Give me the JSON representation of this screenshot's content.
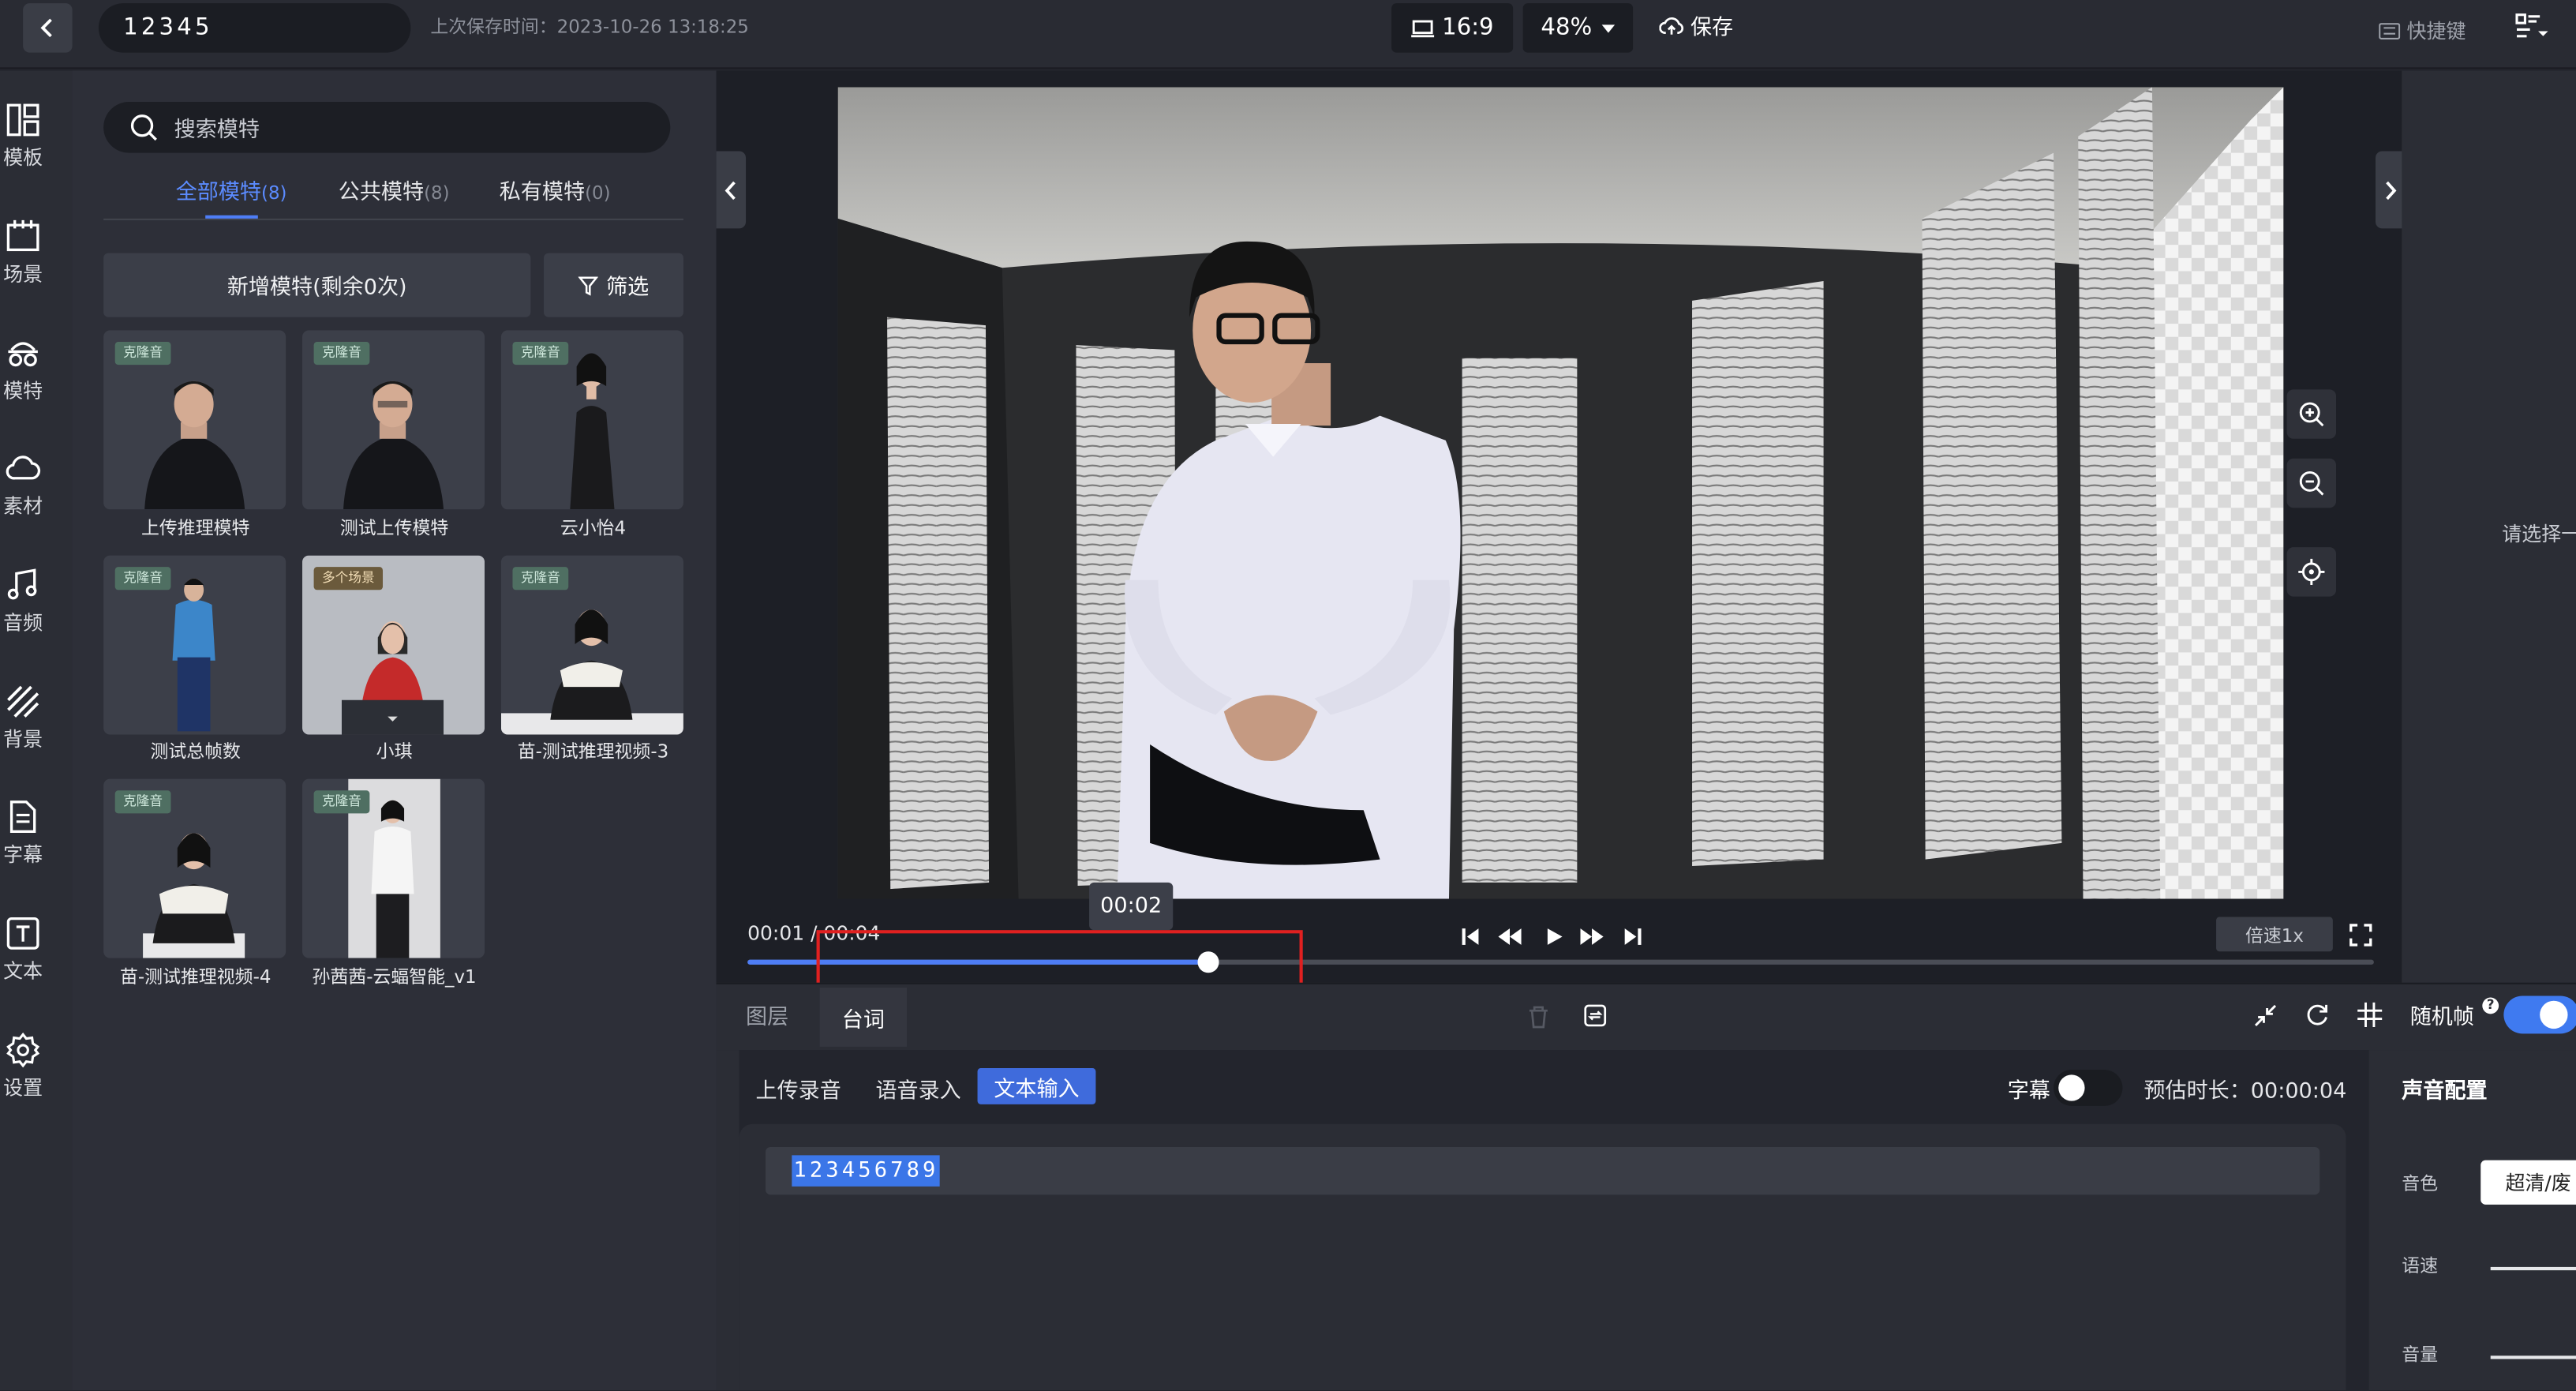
{
  "header": {
    "project_name": "12345",
    "last_saved": "上次保存时间：2023-10-26 13:18:25",
    "aspect_ratio": "16:9",
    "zoom": "48%",
    "save_label": "保存",
    "shortcut_label": "快捷键"
  },
  "left_rail": {
    "items": [
      {
        "label": "模板",
        "icon": "template-icon"
      },
      {
        "label": "场景",
        "icon": "scene-icon"
      },
      {
        "label": "模特",
        "icon": "model-icon"
      },
      {
        "label": "素材",
        "icon": "material-icon"
      },
      {
        "label": "音频",
        "icon": "audio-icon"
      },
      {
        "label": "背景",
        "icon": "background-icon"
      },
      {
        "label": "字幕",
        "icon": "subtitle-icon"
      },
      {
        "label": "文本",
        "icon": "text-icon"
      },
      {
        "label": "设置",
        "icon": "settings-icon"
      }
    ]
  },
  "model_panel": {
    "search_placeholder": "搜索模特",
    "tabs": [
      {
        "label": "全部模特",
        "count": "(8)",
        "active": true
      },
      {
        "label": "公共模特",
        "count": "(8)",
        "active": false
      },
      {
        "label": "私有模特",
        "count": "(0)",
        "active": false
      }
    ],
    "add_model_label": "新增模特(剩余0次)",
    "filter_label": "筛选",
    "models": [
      {
        "name": "上传推理模特",
        "badge": "克隆音"
      },
      {
        "name": "测试上传模特",
        "badge": "克隆音"
      },
      {
        "name": "云小怡4",
        "badge": "克隆音"
      },
      {
        "name": "测试总帧数",
        "badge": "克隆音"
      },
      {
        "name": "小琪",
        "badge": "多个场景"
      },
      {
        "name": "苗-测试推理视频-3",
        "badge": "克隆音"
      },
      {
        "name": "苗-测试推理视频-4",
        "badge": "克隆音"
      },
      {
        "name": "孙茜茜-云蝠智能_v1",
        "badge": "克隆音"
      }
    ]
  },
  "player": {
    "current_time": "00:01",
    "total_time": "00:04",
    "time_separator": " / ",
    "hover_time": "00:02",
    "progress_fraction": 0.283,
    "speed_label": "倍速1x"
  },
  "right_panel": {
    "placeholder": "请选择一"
  },
  "bottom": {
    "tabs": [
      {
        "label": "图层",
        "active": false
      },
      {
        "label": "台词",
        "active": true
      }
    ],
    "random_frame_label": "随机帧",
    "random_frame_on": true,
    "source_tabs": [
      "上传录音",
      "语音录入",
      "文本输入"
    ],
    "subtitle_label": "字幕",
    "subtitle_on": false,
    "estimated_duration": "预估时长：00:00:04",
    "script_text": "123456789"
  },
  "voice_config": {
    "title": "声音配置",
    "timbre_label": "音色",
    "timbre_value": "超清/废",
    "speed_label": "语速",
    "volume_label": "音量"
  },
  "colors": {
    "accent": "#4e7df5",
    "highlight_border": "#e02020"
  }
}
